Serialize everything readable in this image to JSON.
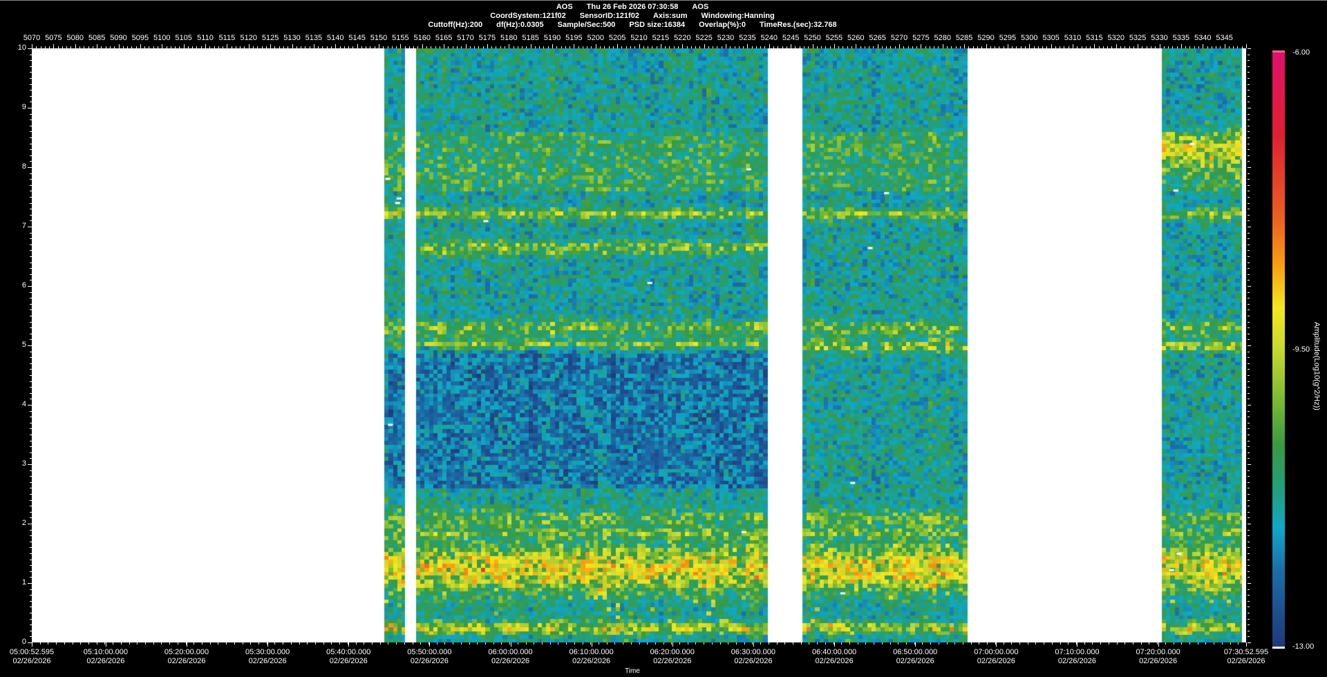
{
  "header": {
    "line1": [
      "AOS",
      "Thu 26 Feb 2026 07:30:58",
      "AOS"
    ],
    "line2": [
      "CoordSystem:121f02",
      "SensorID:121f02",
      "Axis:sum",
      "Windowing:Hanning"
    ],
    "line3": [
      "Cuttoff(Hz):200",
      "df(Hz):0.0305",
      "Sample/Sec:500",
      "PSD size:16384",
      "Overlap(%):0",
      "TimeRes.(sec):32.768"
    ]
  },
  "chart_data": {
    "type": "heatmap",
    "title": "AOS Thu 26 Feb 2026 07:30:58 AOS",
    "xlabel": "Time",
    "ylabel": "",
    "x_range_minutes": [
      0,
      150
    ],
    "x_start": "05:00:52.595",
    "x_ticks": [
      {
        "min": 0,
        "time": "05:00:52.595",
        "date": "02/26/2026"
      },
      {
        "min": 9.1234,
        "time": "05:10:00.000",
        "date": "02/26/2026"
      },
      {
        "min": 19.1234,
        "time": "05:20:00.000",
        "date": "02/26/2026"
      },
      {
        "min": 29.1234,
        "time": "05:30:00.000",
        "date": "02/26/2026"
      },
      {
        "min": 39.1234,
        "time": "05:40:00.000",
        "date": "02/26/2026"
      },
      {
        "min": 49.1234,
        "time": "05:50:00.000",
        "date": "02/26/2026"
      },
      {
        "min": 59.1234,
        "time": "06:00:00.000",
        "date": "02/26/2026"
      },
      {
        "min": 69.1234,
        "time": "06:10:00.000",
        "date": "02/26/2026"
      },
      {
        "min": 79.1234,
        "time": "06:20:00.000",
        "date": "02/26/2026"
      },
      {
        "min": 89.1234,
        "time": "06:30:00.000",
        "date": "02/26/2026"
      },
      {
        "min": 99.1234,
        "time": "06:40:00.000",
        "date": "02/26/2026"
      },
      {
        "min": 109.1234,
        "time": "06:50:00.000",
        "date": "02/26/2026"
      },
      {
        "min": 119.1234,
        "time": "07:00:00.000",
        "date": "02/26/2026"
      },
      {
        "min": 129.1234,
        "time": "07:10:00.000",
        "date": "02/26/2026"
      },
      {
        "min": 139.1234,
        "time": "07:20:00.000",
        "date": "02/26/2026"
      },
      {
        "min": 150,
        "time": "07:30:52.595",
        "date": "02/26/2026"
      }
    ],
    "record_range": [
      5070,
      5350
    ],
    "record_labels": [
      5070,
      5075,
      5080,
      5085,
      5090,
      5095,
      5100,
      5105,
      5110,
      5115,
      5120,
      5125,
      5130,
      5135,
      5140,
      5145,
      5150,
      5155,
      5160,
      5165,
      5170,
      5175,
      5180,
      5185,
      5190,
      5195,
      5200,
      5205,
      5210,
      5215,
      5220,
      5225,
      5230,
      5235,
      5240,
      5245,
      5250,
      5255,
      5260,
      5265,
      5270,
      5275,
      5280,
      5285,
      5290,
      5295,
      5300,
      5305,
      5310,
      5315,
      5320,
      5325,
      5330,
      5335,
      5340,
      5345
    ],
    "ylim": [
      0,
      10
    ],
    "y_ticks": [
      "0",
      "1",
      "2",
      "3",
      "4",
      "5",
      "6",
      "7",
      "8",
      "9",
      "10"
    ],
    "colorbar": {
      "min": -13.0,
      "max": -6.0,
      "labels": [
        "-6.00",
        "-9.50",
        "-13.00"
      ],
      "title": "Amplitude(Log10(g^2/Hz))"
    },
    "data_segments_minutes": [
      [
        43.6,
        46.0
      ],
      [
        47.5,
        90.8
      ],
      [
        95.2,
        115.5
      ],
      [
        139.6,
        149.4
      ]
    ],
    "baseline_amplitude": -11.0,
    "bands": [
      {
        "freq": 7.22,
        "width": 0.08,
        "amplitude": -9.7
      },
      {
        "freq": 6.65,
        "width": 0.12,
        "amplitude": -10.0,
        "segment": 1
      },
      {
        "freq": 5.3,
        "width": 0.12,
        "amplitude": -10.0
      },
      {
        "freq": 5.0,
        "width": 0.1,
        "amplitude": -9.8
      },
      {
        "freq": 8.3,
        "width": 0.35,
        "amplitude": -9.9,
        "segment": 3
      },
      {
        "freq": 2.1,
        "width": 0.15,
        "amplitude": -10.2
      },
      {
        "freq": 1.85,
        "width": 0.08,
        "amplitude": -10.1
      },
      {
        "freq": 1.25,
        "width": 0.4,
        "amplitude": -9.2
      },
      {
        "freq": 0.25,
        "width": 0.1,
        "amplitude": -9.6
      }
    ],
    "low_regions": [
      {
        "fmin": 2.6,
        "fmax": 5.0,
        "amplitude": -12.0
      }
    ]
  },
  "colors": {
    "background": "#000000",
    "plot_bg": "#ffffff",
    "text": "#ffffff"
  }
}
